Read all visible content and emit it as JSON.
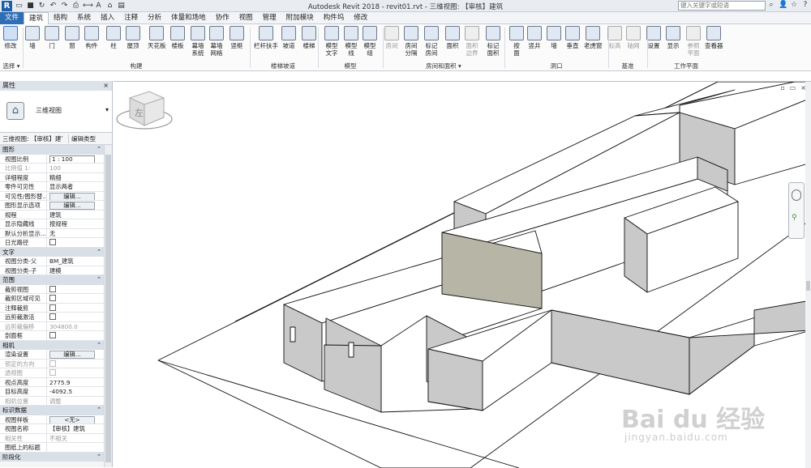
{
  "app": {
    "title": "Autodesk Revit 2018 -  revit01.rvt - 三维视图: 【审核】建筑",
    "search_placeholder": "键入关键字或短语"
  },
  "menu": {
    "items": [
      "文件",
      "建筑",
      "结构",
      "系统",
      "插入",
      "注释",
      "分析",
      "体量和场地",
      "协作",
      "视图",
      "管理",
      "附加模块",
      "构件坞",
      "修改"
    ],
    "active": "建筑"
  },
  "ribbon": {
    "buttons": [
      {
        "label": "修改",
        "icon": "modify-icon"
      },
      {
        "label": "墙",
        "icon": "wall-icon"
      },
      {
        "label": "门",
        "icon": "door-icon"
      },
      {
        "label": "窗",
        "icon": "window-icon"
      },
      {
        "label": "构件",
        "icon": "component-icon"
      },
      {
        "label": "柱",
        "icon": "column-icon"
      },
      {
        "label": "屋顶",
        "icon": "roof-icon"
      },
      {
        "label": "天花板",
        "icon": "ceiling-icon"
      },
      {
        "label": "楼板",
        "icon": "floor-icon"
      },
      {
        "label": "幕墙\n系统",
        "icon": "curtain-system-icon"
      },
      {
        "label": "幕墙\n网格",
        "icon": "curtain-grid-icon"
      },
      {
        "label": "竖梃",
        "icon": "mullion-icon"
      },
      {
        "label": "栏杆扶手",
        "icon": "railing-icon"
      },
      {
        "label": "坡道",
        "icon": "ramp-icon"
      },
      {
        "label": "楼梯",
        "icon": "stair-icon"
      },
      {
        "label": "模型\n文字",
        "icon": "model-text-icon"
      },
      {
        "label": "模型\n线",
        "icon": "model-line-icon"
      },
      {
        "label": "模型\n组",
        "icon": "model-group-icon"
      },
      {
        "label": "房间",
        "icon": "room-icon"
      },
      {
        "label": "房间\n分隔",
        "icon": "room-separator-icon"
      },
      {
        "label": "标记\n房间",
        "icon": "tag-room-icon"
      },
      {
        "label": "面积",
        "icon": "area-icon"
      },
      {
        "label": "面积\n边界",
        "icon": "area-boundary-icon"
      },
      {
        "label": "标记\n面积",
        "icon": "tag-area-icon"
      },
      {
        "label": "按\n面",
        "icon": "by-face-icon"
      },
      {
        "label": "竖井",
        "icon": "shaft-icon"
      },
      {
        "label": "墙",
        "icon": "wall-opening-icon"
      },
      {
        "label": "垂直",
        "icon": "vertical-icon"
      },
      {
        "label": "老虎窗",
        "icon": "dormer-icon"
      },
      {
        "label": "标高",
        "icon": "level-icon"
      },
      {
        "label": "轴网",
        "icon": "grid-icon"
      },
      {
        "label": "设置",
        "icon": "set-icon"
      },
      {
        "label": "显示",
        "icon": "show-icon"
      },
      {
        "label": "参照\n平面",
        "icon": "ref-plane-icon"
      },
      {
        "label": "查看器",
        "icon": "viewer-icon"
      }
    ],
    "panels": [
      "选择 ▾",
      "构建",
      "楼梯坡道",
      "模型",
      "房间和面积 ▾",
      "洞口",
      "基准",
      "工作平面"
    ]
  },
  "properties": {
    "title": "属性",
    "type_name": "三维视图",
    "instance_selector": "三维视图: 【审核】建’",
    "edit_type": "编辑类型",
    "groups": [
      {
        "name": "图形",
        "rows": [
          {
            "name": "视图比例",
            "value": "1 : 100",
            "kind": "input"
          },
          {
            "name": "比例值 1:",
            "value": "100",
            "dim": true
          },
          {
            "name": "详细程度",
            "value": "精细"
          },
          {
            "name": "零件可见性",
            "value": "显示两者"
          },
          {
            "name": "可见性/图形替...",
            "value": "编辑...",
            "kind": "button"
          },
          {
            "name": "图形显示选项",
            "value": "编辑...",
            "kind": "button"
          },
          {
            "name": "规程",
            "value": "建筑"
          },
          {
            "name": "显示隐藏线",
            "value": "按规程"
          },
          {
            "name": "默认分析显示...",
            "value": "无"
          },
          {
            "name": "日光路径",
            "value": "",
            "kind": "checkbox"
          }
        ]
      },
      {
        "name": "文字",
        "rows": [
          {
            "name": "视图分类-父",
            "value": "BM_建筑"
          },
          {
            "name": "视图分类-子",
            "value": "建模"
          }
        ]
      },
      {
        "name": "范围",
        "rows": [
          {
            "name": "裁剪视图",
            "value": "",
            "kind": "checkbox"
          },
          {
            "name": "裁剪区域可见",
            "value": "",
            "kind": "checkbox"
          },
          {
            "name": "注释裁剪",
            "value": "",
            "kind": "checkbox"
          },
          {
            "name": "远剪裁激活",
            "value": "",
            "kind": "checkbox"
          },
          {
            "name": "远剪裁偏移",
            "value": "304800.0",
            "dim": true
          },
          {
            "name": "剖面框",
            "value": "",
            "kind": "checkbox"
          }
        ]
      },
      {
        "name": "相机",
        "rows": [
          {
            "name": "渲染设置",
            "value": "编辑...",
            "kind": "button"
          },
          {
            "name": "锁定的方向",
            "value": "",
            "kind": "checkbox",
            "dim": true
          },
          {
            "name": "透视图",
            "value": "",
            "kind": "checkbox",
            "dim": true
          },
          {
            "name": "视点高度",
            "value": "2775.9"
          },
          {
            "name": "目标高度",
            "value": "-4092.5"
          },
          {
            "name": "相机位置",
            "value": "调整",
            "dim": true
          }
        ]
      },
      {
        "name": "标识数据",
        "rows": [
          {
            "name": "视图样板",
            "value": "<无>",
            "kind": "button"
          },
          {
            "name": "视图名称",
            "value": "【审核】建筑"
          },
          {
            "name": "相关性",
            "value": "不相关",
            "dim": true
          },
          {
            "name": "图纸上的标题",
            "value": ""
          }
        ]
      },
      {
        "name": "阶段化",
        "rows": []
      }
    ]
  },
  "viewport": {
    "viewcube_label": "左",
    "wall_shade_color": "#b7b6a6",
    "wall_side_color": "#c9c9c9"
  },
  "watermark": {
    "main": "Bai du 经验",
    "sub": "jingyan.baidu.com"
  }
}
